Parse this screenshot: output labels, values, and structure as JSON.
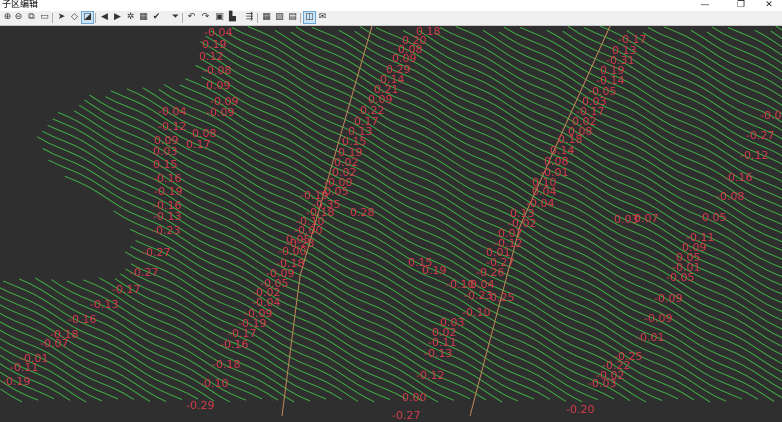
{
  "window": {
    "title": "子区编辑",
    "minimize": "—",
    "maximize": "❐",
    "close": "✕"
  },
  "toolbar": [
    {
      "name": "zoom-in-icon",
      "glyph": "⊕"
    },
    {
      "name": "zoom-out-icon",
      "glyph": "⊖"
    },
    {
      "name": "zoom-window-icon",
      "glyph": "⧉"
    },
    {
      "name": "pan-icon",
      "glyph": "▭"
    },
    {
      "name": "select-arrow-icon",
      "glyph": "➤"
    },
    {
      "name": "eraser-icon",
      "glyph": "◇"
    },
    {
      "name": "edit-icon",
      "glyph": "◪",
      "selected": true
    },
    {
      "name": "step-back-icon",
      "glyph": "◀"
    },
    {
      "name": "step-forward-icon",
      "glyph": "▶"
    },
    {
      "name": "settings-icon",
      "glyph": "✲"
    },
    {
      "name": "palette-icon",
      "glyph": "▦"
    },
    {
      "name": "check-dropdown-icon",
      "glyph": "✔"
    },
    {
      "name": "filter-icon",
      "glyph": "⏷"
    },
    {
      "name": "undo-icon",
      "glyph": "↶"
    },
    {
      "name": "redo-icon",
      "glyph": "↷"
    },
    {
      "name": "save-icon",
      "glyph": "▣"
    },
    {
      "name": "chart-dropdown-icon",
      "glyph": "▙"
    },
    {
      "name": "export-icon",
      "glyph": "⇶"
    },
    {
      "name": "grid-icon",
      "glyph": "▦"
    },
    {
      "name": "image-icon",
      "glyph": "▨"
    },
    {
      "name": "layer-icon",
      "glyph": "▤"
    },
    {
      "name": "view-toggle-icon",
      "glyph": "◫",
      "selected": true
    },
    {
      "name": "mail-icon",
      "glyph": "✉"
    }
  ],
  "colors": {
    "background": "#2f2f2f",
    "contour": "#3fae44",
    "boundary": "#c08858",
    "label": "#d23b4b"
  },
  "labels": [
    "-0.04",
    "0.19",
    "0.12",
    "-0.08",
    "0.09",
    "-0.09",
    "-0.09",
    "-0.04",
    "-0.12",
    "0.08",
    "0.17",
    "0.09",
    "0.03",
    "0.15",
    "-0.16",
    "-0.19",
    "-0.16",
    "-0.13",
    "-0.23",
    "-0.27",
    "-0.27",
    "-0.17",
    "-0.13",
    "-0.16",
    "-0.18",
    "-0.07",
    "-0.01",
    "-0.11",
    "-0.19",
    "0.18",
    "0.20",
    "0.08",
    "0.09",
    "0.29",
    "0.14",
    "0.21",
    "0.09",
    "0.22",
    "0.17",
    "0.13",
    "0.15",
    "0.19",
    "0.02",
    "0.02",
    "-0.00",
    "-0.05",
    "-0.19",
    "-0.35",
    "0.28",
    "-0.18",
    "-0.10",
    "-0.00",
    "0.05",
    "-0.23",
    "-0.00",
    "-0.18",
    "-0.09",
    "-0.05",
    "-0.02",
    "-0.04",
    "-0.09",
    "-0.19",
    "-0.17",
    "-0.16",
    "-0.18",
    "-0.10",
    "-0.29",
    "0.00",
    "-0.27",
    "0.15",
    "0.19",
    "-0.10",
    "0.04",
    "-0.23",
    "0.25",
    "-0.26",
    "-0.27",
    "0.01",
    "-0.12",
    "0.07",
    "-0.02",
    "0.13",
    "-0.04",
    "0.04",
    "0.10",
    "-0.01",
    "0.08",
    "0.14",
    "0.18",
    "0.08",
    "0.02",
    "-0.17",
    "0.03",
    "-0.05",
    "-0.14",
    "0.19",
    "-0.31",
    "0.13",
    "-0.17",
    "-0.10",
    "0.03",
    "0.02",
    "-0.11",
    "-0.13",
    "-0.12",
    "0.03",
    "0.07",
    "0.05",
    "-0.11",
    "0.09",
    "0.05",
    "-0.01",
    "-0.05",
    "-0.09",
    "-0.09",
    "-0.01",
    "-0.25",
    "-0.22",
    "-0.02",
    "-0.03",
    "-0.20",
    "-0.08",
    "-0.16",
    "-0.12",
    "-0.27",
    "-0.0"
  ]
}
